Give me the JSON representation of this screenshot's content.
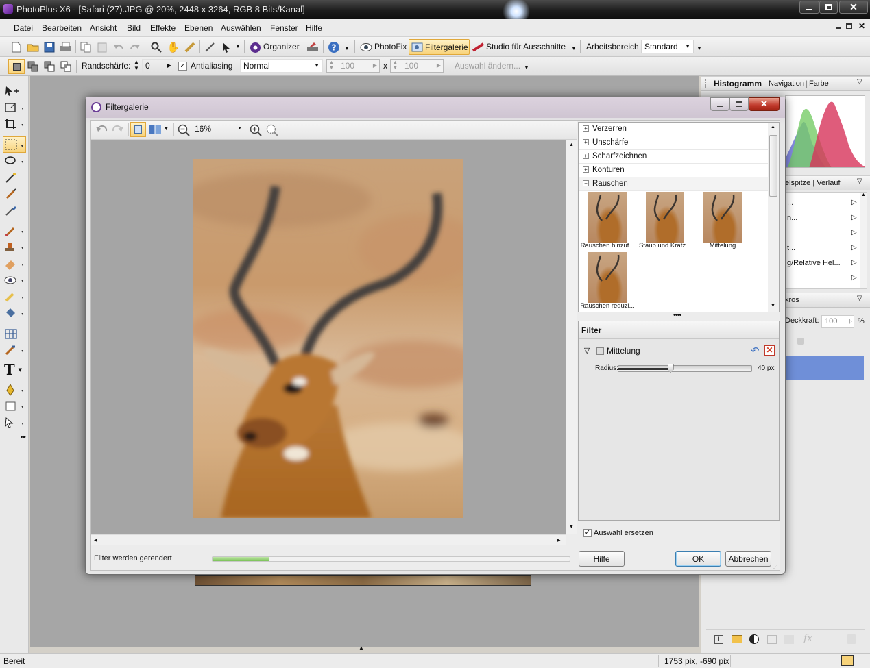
{
  "app": {
    "title": "PhotoPlus X6 - [Safari (27).JPG @ 20%, 2448 x 3264, RGB 8 Bits/Kanal]"
  },
  "menu": [
    "Datei",
    "Bearbeiten",
    "Ansicht",
    "Bild",
    "Effekte",
    "Ebenen",
    "Auswählen",
    "Fenster",
    "Hilfe"
  ],
  "toolbar": {
    "organizer": "Organizer",
    "photofix": "PhotoFix",
    "filtergalerie": "Filtergalerie",
    "studio": "Studio für Ausschnitte",
    "arbeitsbereich_label": "Arbeitsbereich",
    "arbeitsbereich_value": "Standard"
  },
  "context_toolbar": {
    "randschaerfe_label": "Randschärfe:",
    "randschaerfe_value": "0",
    "antialiasing_label": "Antialiasing",
    "mode_value": "Normal",
    "width_value": "100",
    "x_label": "x",
    "height_value": "100",
    "auswahl_aendern": "Auswahl ändern..."
  },
  "right_panel": {
    "tab_histogramm": "Histogramm",
    "tab_navigation": "Navigation",
    "tab_farbe": "Farbe",
    "second_tabs": "elspitze | Verlauf",
    "list_items": [
      "...",
      "n...",
      "",
      "t...",
      "g/Relative Hel...",
      ""
    ],
    "third_header": "kros",
    "deckkraft_label": "Deckkraft:",
    "deckkraft_value": "100",
    "percent": "%"
  },
  "status": {
    "left": "Bereit",
    "coords": "1753 pix, -690 pix"
  },
  "dialog": {
    "title": "Filtergalerie",
    "zoom": "16%",
    "categories": [
      {
        "sign": "+",
        "label": "Verzerren"
      },
      {
        "sign": "+",
        "label": "Unschärfe"
      },
      {
        "sign": "+",
        "label": "Scharfzeichnen"
      },
      {
        "sign": "+",
        "label": "Konturen"
      },
      {
        "sign": "−",
        "label": "Rauschen"
      }
    ],
    "thumbnails": [
      "Rauschen hinzuf...",
      "Staub und Kratz...",
      "Mittelung",
      "Rauschen reduzi..."
    ],
    "filter_header": "Filter",
    "active_filter": "Mittelung",
    "radius_label": "Radius:",
    "radius_value": "40 px",
    "radius_fraction": 0.39,
    "replace_selection": "Auswahl ersetzen",
    "status_text": "Filter werden gerendert",
    "progress": 0.16,
    "btn_help": "Hilfe",
    "btn_ok": "OK",
    "btn_cancel": "Abbrechen"
  }
}
